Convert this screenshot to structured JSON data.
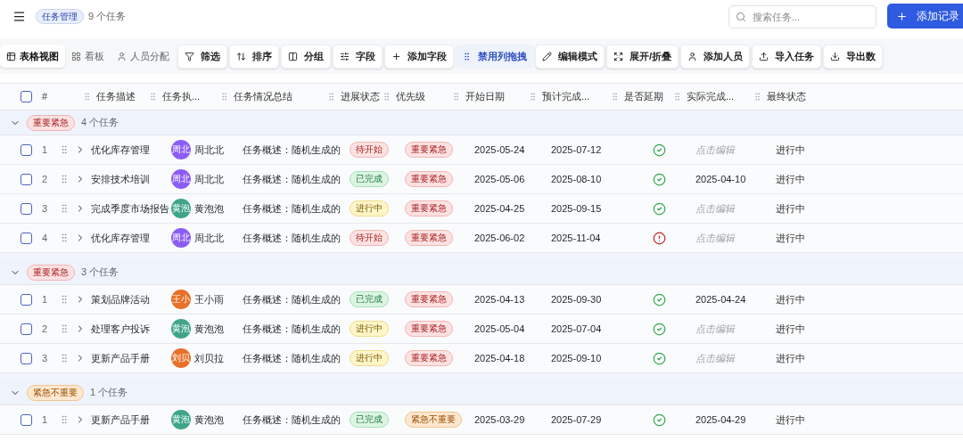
{
  "header": {
    "tag": "任务管理",
    "count": "9 个任务",
    "search": {
      "placeholder": "搜索任务..."
    },
    "add_button": "添加记录"
  },
  "toolbar": {
    "views": [
      {
        "label": "表格视图",
        "selected": true
      },
      {
        "label": "看板",
        "selected": false
      },
      {
        "label": "人员分配",
        "selected": false
      }
    ],
    "buttons": [
      {
        "label": "筛选",
        "active": false
      },
      {
        "label": "排序",
        "active": false
      },
      {
        "label": "分组",
        "active": false
      },
      {
        "label": "字段",
        "active": false
      },
      {
        "label": "添加字段",
        "active": false
      },
      {
        "label": "禁用列拖拽",
        "active": true
      },
      {
        "label": "编辑模式",
        "active": false
      },
      {
        "label": "展开/折叠",
        "active": false
      },
      {
        "label": "添加人员",
        "active": false
      },
      {
        "label": "导入任务",
        "active": false
      },
      {
        "label": "导出数",
        "active": false
      }
    ]
  },
  "table": {
    "select_all": {
      "checked": false
    },
    "columns": [
      "#",
      "任务描述",
      "任务执...",
      "任务情况总结",
      "进展状态",
      "优先级",
      "开始日期",
      "预计完成...",
      "是否延期",
      "实际完成...",
      "最终状态"
    ],
    "groups": [
      {
        "tag": {
          "label": "重要紧急",
          "color": "#fde2e2"
        },
        "count": "4 个任务",
        "expanded": true,
        "rows": [
          {
            "no": "1",
            "checked": false,
            "expanded": false,
            "task": "优化库存管理",
            "avatar": {
              "text": "周北",
              "color": "#8b5cf6"
            },
            "owner": "周北北",
            "summary": "任务概述：随机生成的",
            "status": {
              "label": "待开始",
              "color": "#fde2e2"
            },
            "priority": {
              "label": "重要紧急",
              "color": "#fde2e2"
            },
            "start": "2025-05-24",
            "due": "2025-07-12",
            "overdue": false,
            "actual": {
              "placeholder": "点击编辑"
            },
            "final": "进行中"
          },
          {
            "no": "2",
            "checked": false,
            "expanded": false,
            "task": "安排技术培训",
            "avatar": {
              "text": "周北",
              "color": "#8b5cf6"
            },
            "owner": "周北北",
            "summary": "任务概述：随机生成的",
            "status": {
              "label": "已完成",
              "color": "#dcf5e3"
            },
            "priority": {
              "label": "重要紧急",
              "color": "#fde2e2"
            },
            "start": "2025-05-06",
            "due": "2025-08-10",
            "overdue": false,
            "actual": {
              "value": "2025-04-10"
            },
            "final": "进行中"
          },
          {
            "no": "3",
            "checked": false,
            "expanded": false,
            "task": "完成季度市场报告",
            "avatar": {
              "text": "黄泡",
              "color": "#3fa58a"
            },
            "owner": "黄泡泡",
            "summary": "任务概述：随机生成的",
            "status": {
              "label": "进行中",
              "color": "#fff6c9"
            },
            "priority": {
              "label": "重要紧急",
              "color": "#fde2e2"
            },
            "start": "2025-04-25",
            "due": "2025-09-15",
            "overdue": false,
            "actual": {
              "placeholder": "点击编辑"
            },
            "final": "进行中"
          },
          {
            "no": "4",
            "checked": false,
            "expanded": false,
            "task": "优化库存管理",
            "avatar": {
              "text": "周北",
              "color": "#8b5cf6"
            },
            "owner": "周北北",
            "summary": "任务概述：随机生成的",
            "status": {
              "label": "待开始",
              "color": "#fde2e2"
            },
            "priority": {
              "label": "重要紧急",
              "color": "#fde2e2"
            },
            "start": "2025-06-02",
            "due": "2025-11-04",
            "overdue": true,
            "actual": {
              "placeholder": "点击编辑"
            },
            "final": "进行中"
          }
        ]
      },
      {
        "tag": {
          "label": "重要紧急",
          "color": "#fde2e2"
        },
        "count": "3 个任务",
        "expanded": true,
        "rows": [
          {
            "no": "1",
            "checked": false,
            "expanded": false,
            "task": "策划品牌活动",
            "avatar": {
              "text": "王小",
              "color": "#e8702a"
            },
            "owner": "王小雨",
            "summary": "任务概述：随机生成的",
            "status": {
              "label": "已完成",
              "color": "#dcf5e3"
            },
            "priority": {
              "label": "重要紧急",
              "color": "#fde2e2"
            },
            "start": "2025-04-13",
            "due": "2025-09-30",
            "overdue": false,
            "actual": {
              "value": "2025-04-24"
            },
            "final": "进行中"
          },
          {
            "no": "2",
            "checked": false,
            "expanded": false,
            "task": "处理客户投诉",
            "avatar": {
              "text": "黄泡",
              "color": "#3fa58a"
            },
            "owner": "黄泡泡",
            "summary": "任务概述：随机生成的",
            "status": {
              "label": "进行中",
              "color": "#fff6c9"
            },
            "priority": {
              "label": "重要紧急",
              "color": "#fde2e2"
            },
            "start": "2025-05-04",
            "due": "2025-07-04",
            "overdue": false,
            "actual": {
              "placeholder": "点击编辑"
            },
            "final": "进行中"
          },
          {
            "no": "3",
            "checked": false,
            "expanded": false,
            "task": "更新产品手册",
            "avatar": {
              "text": "刘贝",
              "color": "#e8702a"
            },
            "owner": "刘贝拉",
            "summary": "任务概述：随机生成的",
            "status": {
              "label": "进行中",
              "color": "#fff6c9"
            },
            "priority": {
              "label": "重要紧急",
              "color": "#fde2e2"
            },
            "start": "2025-04-18",
            "due": "2025-09-10",
            "overdue": false,
            "actual": {
              "placeholder": "点击编辑"
            },
            "final": "进行中"
          }
        ]
      },
      {
        "tag": {
          "label": "紧急不重要",
          "color": "#fde8cf"
        },
        "count": "1 个任务",
        "expanded": true,
        "rows": [
          {
            "no": "1",
            "checked": false,
            "expanded": false,
            "task": "更新产品手册",
            "avatar": {
              "text": "黄泡",
              "color": "#3fa58a"
            },
            "owner": "黄泡泡",
            "summary": "任务概述：随机生成的",
            "status": {
              "label": "已完成",
              "color": "#dcf5e3"
            },
            "priority": {
              "label": "紧急不重要",
              "color": "#fde8cf"
            },
            "start": "2025-03-29",
            "due": "2025-07-29",
            "overdue": false,
            "actual": {
              "value": "2025-04-29"
            },
            "final": "进行中"
          }
        ]
      }
    ]
  }
}
